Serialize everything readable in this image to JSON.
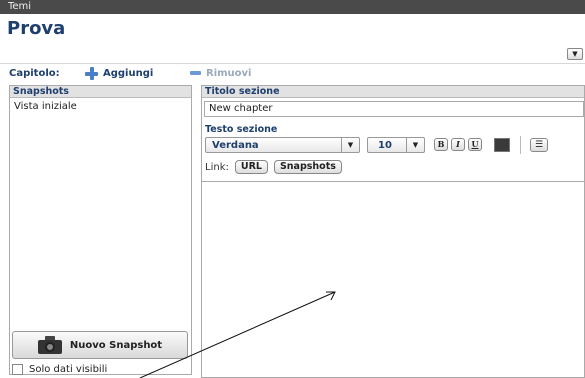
{
  "window": {
    "title": "Temi"
  },
  "page": {
    "title": "Prova"
  },
  "chapter_bar": {
    "label": "Capitolo:",
    "add_label": "Aggiungi",
    "remove_label": "Rimuovi"
  },
  "snapshots_panel": {
    "header": "Snapshots",
    "items": [
      {
        "label": "Vista iniziale"
      }
    ],
    "new_button_label": "Nuovo Snapshot",
    "visible_only_label": "Solo dati visibili",
    "visible_only_checked": false
  },
  "section_panel": {
    "title_header": "Titolo sezione",
    "title_value": "New chapter",
    "text_header": "Testo sezione",
    "font_value": "Verdana",
    "size_value": "10",
    "bold_label": "B",
    "italic_label": "I",
    "underline_label": "U",
    "text_color": "#3a3a3a",
    "link_label": "Link:",
    "url_button_label": "URL",
    "snapshots_button_label": "Snapshots"
  },
  "icons": [
    "plus-icon",
    "minus-icon",
    "camera-icon",
    "list-icon",
    "chevron-down-icon"
  ]
}
